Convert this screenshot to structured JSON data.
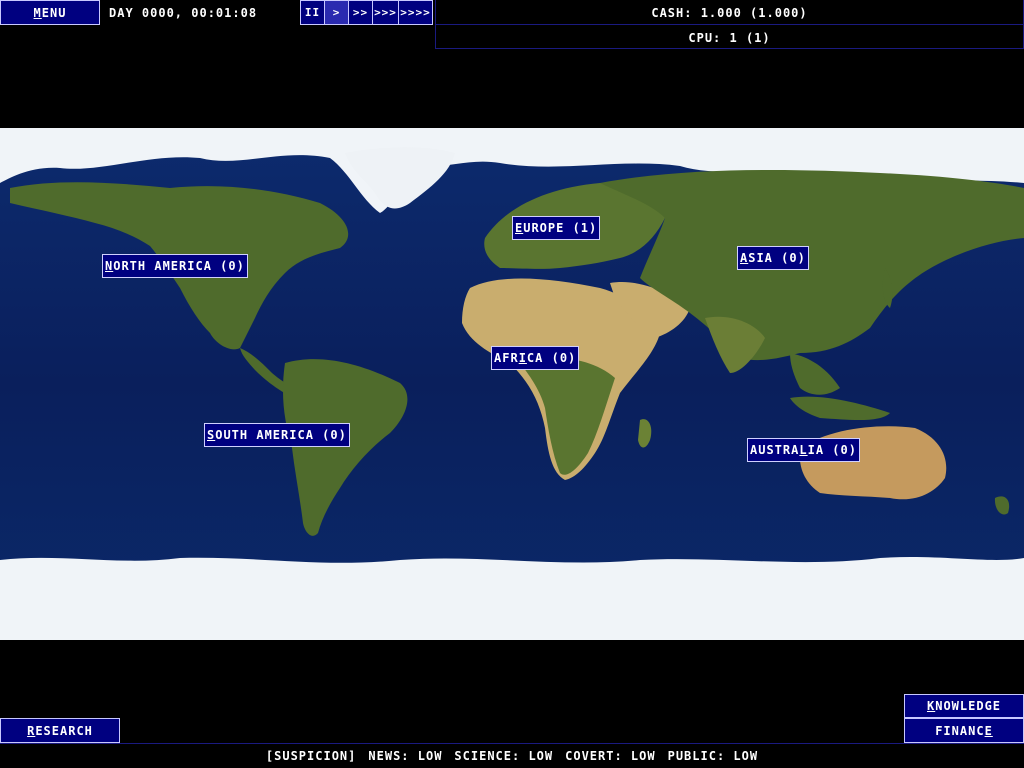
{
  "top_bar": {
    "menu": {
      "first": "M",
      "rest": "ENU"
    },
    "clock": "DAY 0000, 00:01:08",
    "speed_buttons": [
      "II",
      ">",
      ">>",
      ">>>",
      ">>>>"
    ],
    "active_speed": ">",
    "cash": "CASH: 1.000 (1.000)",
    "cpu": "CPU: 1 (1)"
  },
  "regions": {
    "north_america": {
      "first": "N",
      "rest": "ORTH AMERICA (0)"
    },
    "south_america": {
      "first": "S",
      "rest": "OUTH AMERICA (0)"
    },
    "europe": {
      "first": "E",
      "rest": "UROPE (1)"
    },
    "africa": {
      "first": "AFR",
      "u": "I",
      "rest": "CA (0)"
    },
    "asia": {
      "first": "A",
      "rest": "SIA (0)"
    },
    "australia": {
      "first": "AUSTRA",
      "u": "L",
      "rest": "IA (0)"
    }
  },
  "bottom": {
    "knowledge": {
      "first": "K",
      "rest": "NOWLEDGE"
    },
    "finance": {
      "first": "FINANC",
      "u": "E",
      "rest": ""
    },
    "research": {
      "first": "R",
      "rest": "ESEARCH"
    },
    "status": {
      "prefix": "[SUSPICION]",
      "news": "NEWS: LOW",
      "science": "SCIENCE: LOW",
      "covert": "COVERT: LOW",
      "public": "PUBLIC: LOW"
    }
  },
  "colors": {
    "button_bg": "#000080",
    "ocean": "#0a1f5c",
    "land": "#4f6b2c",
    "desert": "#c9ad6e",
    "ice": "#f0f4f8"
  }
}
